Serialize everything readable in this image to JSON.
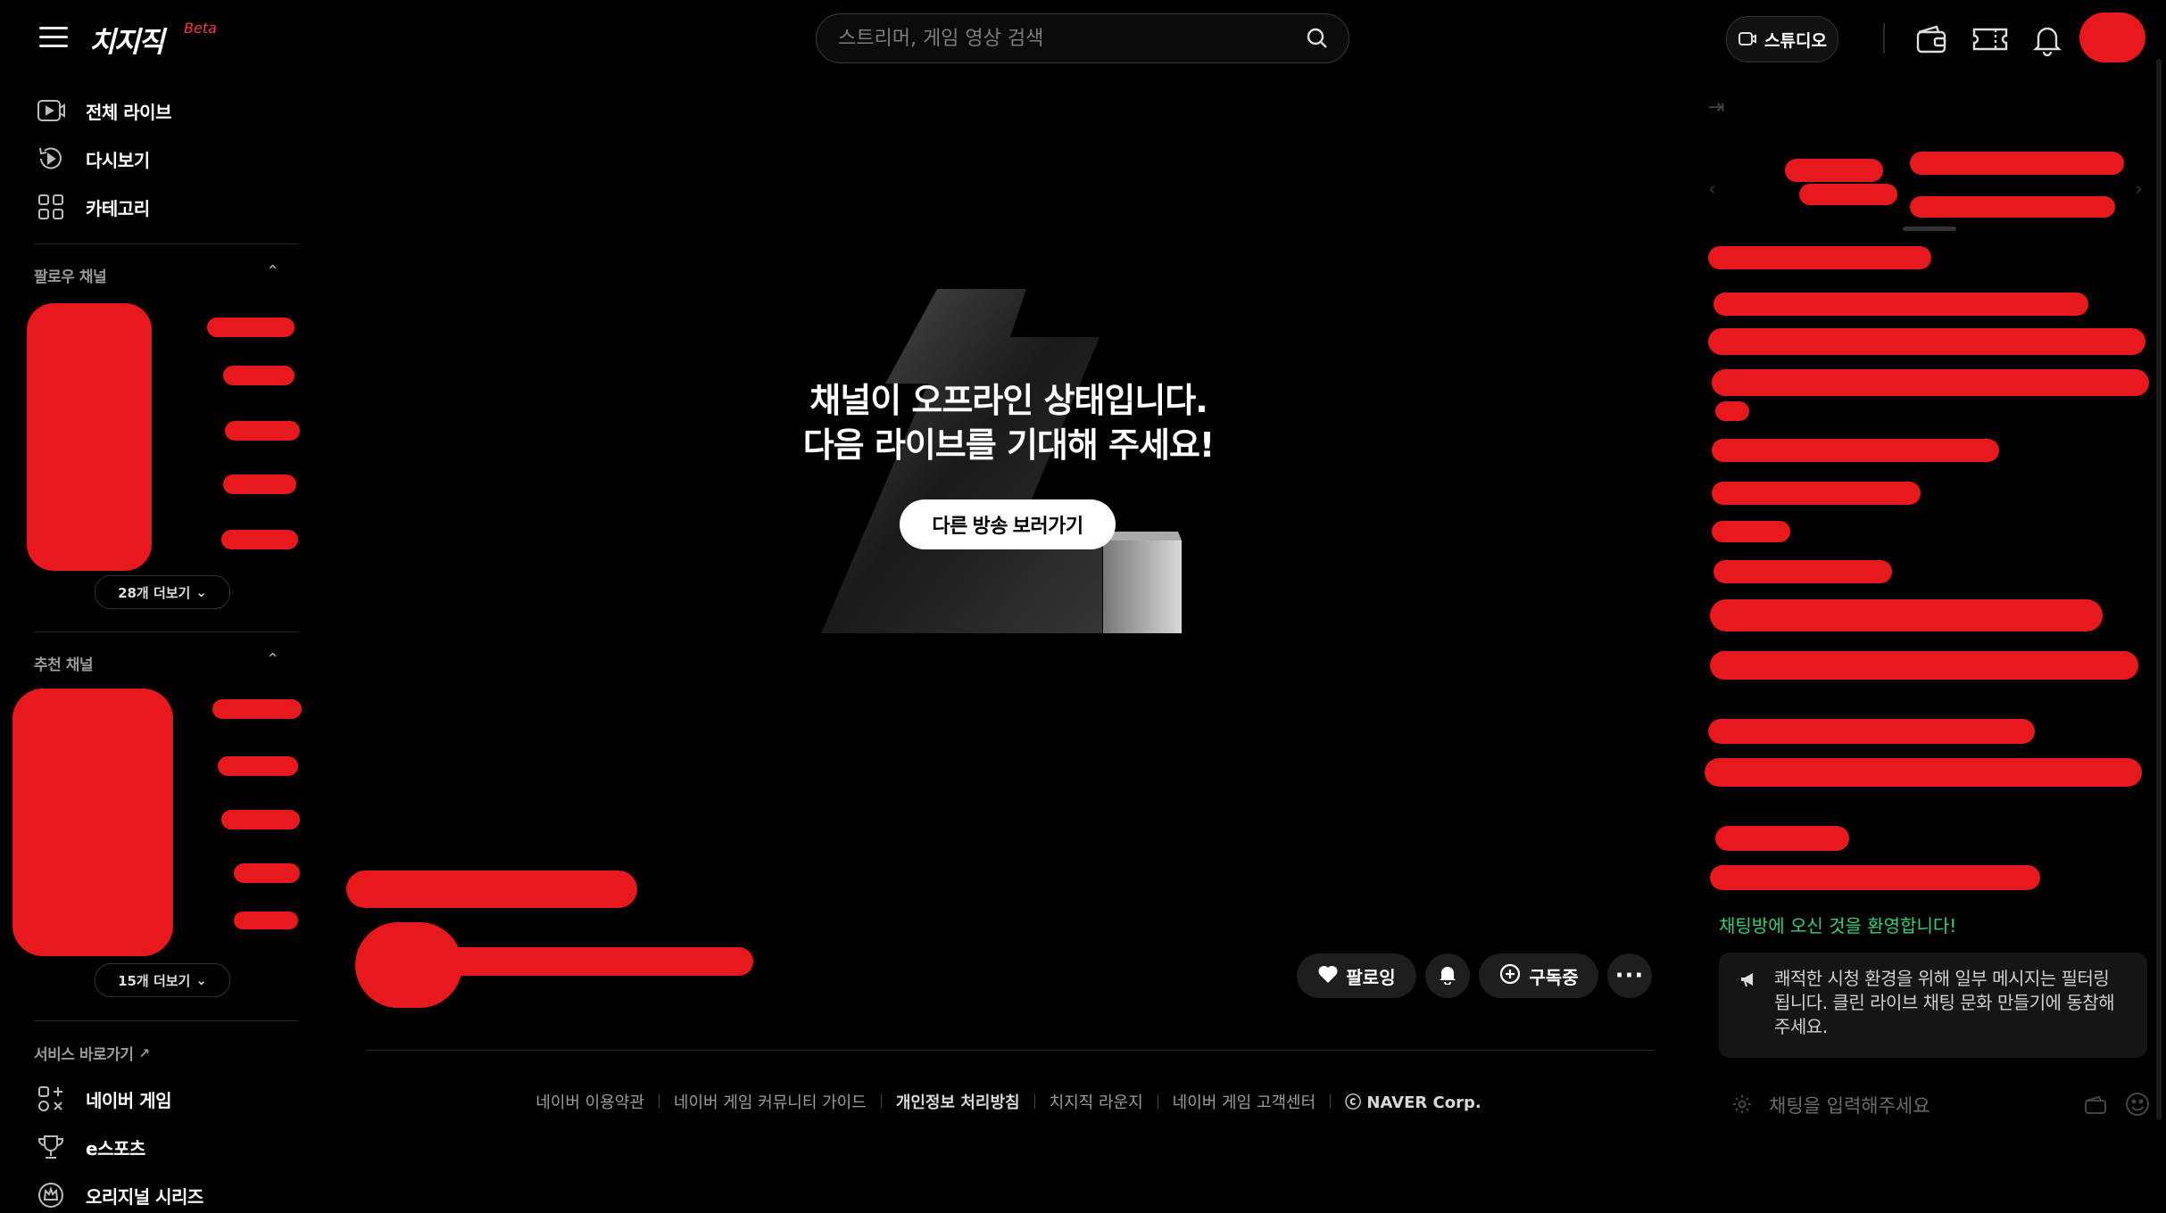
{
  "app": {
    "logo": "치지직",
    "beta": "Beta"
  },
  "search": {
    "placeholder": "스트리머, 게임 영상 검색"
  },
  "header": {
    "studio_label": "스튜디오"
  },
  "nav": {
    "items": [
      {
        "label": "전체 라이브",
        "icon": "live-icon"
      },
      {
        "label": "다시보기",
        "icon": "replay-icon"
      },
      {
        "label": "카테고리",
        "icon": "category-icon"
      }
    ]
  },
  "follow": {
    "title": "팔로우 채널",
    "more_label": "28개 더보기"
  },
  "recommend": {
    "title": "추천 채널",
    "more_label": "15개 더보기"
  },
  "services": {
    "title": "서비스 바로가기",
    "items": [
      {
        "label": "네이버 게임",
        "icon": "game-icon"
      },
      {
        "label": "e스포츠",
        "icon": "trophy-icon"
      },
      {
        "label": "오리지널 시리즈",
        "icon": "crown-icon"
      }
    ]
  },
  "offline": {
    "line1": "채널이 오프라인 상태입니다.",
    "line2": "다음 라이브를 기대해 주세요!",
    "button": "다른 방송 보러가기"
  },
  "actions": {
    "following": "팔로잉",
    "subscribed": "구독중"
  },
  "footer": {
    "links": [
      "네이버 이용약관",
      "네이버 게임 커뮤니티 가이드",
      "개인정보 처리방침",
      "치지직 라운지",
      "네이버 게임 고객센터",
      "ⓒ NAVER Corp."
    ]
  },
  "chat": {
    "welcome": "채팅방에 오신 것을 환영합니다!",
    "notice": "쾌적한 시청 환경을 위해 일부 메시지는 필터링 됩니다. 클린 라이브 채팅 문화 만들기에 동참해 주세요.",
    "input_placeholder": "채팅을 입력해주세요"
  },
  "colors": {
    "accent_green": "#2fd37a",
    "beta_red": "#f03c4a",
    "redaction_red": "#e8191c"
  }
}
